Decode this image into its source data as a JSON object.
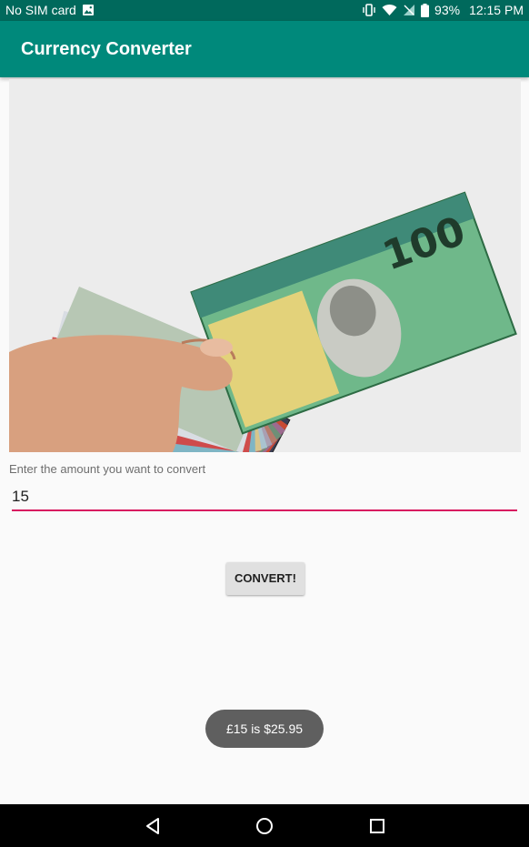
{
  "status_bar": {
    "carrier_text": "No SIM card",
    "battery_percent": "93%",
    "time": "12:15 PM",
    "icons_left": [
      "image-icon"
    ],
    "icons_right": [
      "vibrate-icon",
      "wifi-icon",
      "no-sim-icon",
      "battery-icon"
    ]
  },
  "app_bar": {
    "title": "Currency Converter",
    "color": "#00897b",
    "status_color": "#00695c"
  },
  "hero_image": {
    "description_icon": "banknotes-image"
  },
  "form": {
    "label": "Enter the amount you want to convert",
    "amount_value": "15",
    "underline_color": "#d81b60",
    "convert_label": "CONVERT!"
  },
  "toast": {
    "message": "£15 is $25.95"
  },
  "nav_bar": {
    "icons": [
      "back-icon",
      "home-icon",
      "recents-icon"
    ]
  }
}
